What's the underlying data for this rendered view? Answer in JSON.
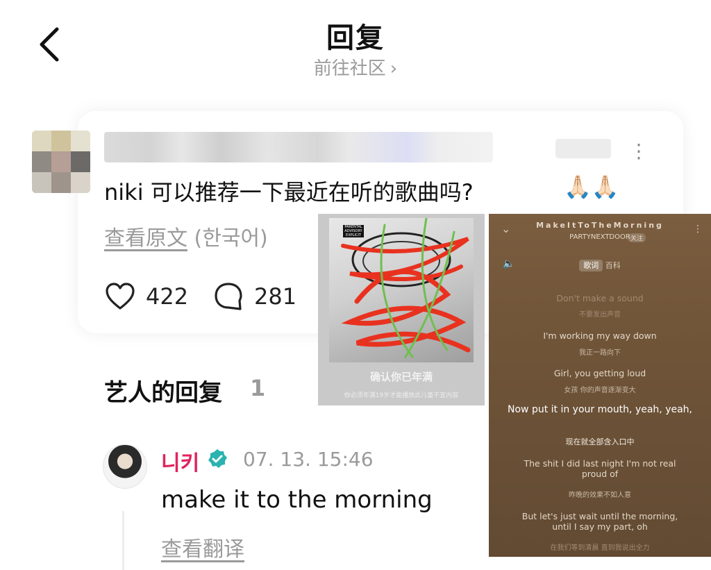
{
  "header": {
    "back_icon": "chevron-left-icon",
    "title": "回复",
    "community_link": "前往社区",
    "community_chevron": "›"
  },
  "comment": {
    "text": "niki 可以推荐一下最近在听的歌曲吗?",
    "emoji": "🙏🏻🙏🏻",
    "view_original": "查看原文",
    "language": "(한국어)",
    "likes": "422",
    "replies": "281",
    "more_icon": "⋮"
  },
  "artist_section": {
    "title": "艺人的回复",
    "count": "1",
    "artist_name": "니키",
    "timestamp": "07. 13. 15:46",
    "reply_text": "make it to the morning",
    "translate_link": "查看翻译"
  },
  "album_overlay": {
    "warning_title": "确认你已年满",
    "warning_sub": "你必须年满19岁才能播放此儿童不宜内容"
  },
  "player": {
    "song_title": "MakeItToTheMorning",
    "artist": "PARTYNEXTDOOR",
    "follow": "关注",
    "tab_lyrics": "歌词",
    "tab_wiki": "百科",
    "lyrics": [
      {
        "en": "Don't make a sound",
        "zh": "不要发出声音"
      },
      {
        "en": "I'm working my way down",
        "zh": "我正一路向下"
      },
      {
        "en": "Girl, you getting loud",
        "zh": "女孩 你的声音逐渐变大"
      },
      {
        "en": "Now put it in your mouth, yeah, yeah,",
        "zh": "现在就全部含入口中"
      },
      {
        "en": "The shit I did last night I'm not real proud of",
        "zh": "昨晚的效果不如人意"
      },
      {
        "en": "But let's just wait until the morning, until I say my part, oh",
        "zh": "在我们等到清晨 直到我说出全力"
      }
    ]
  }
}
